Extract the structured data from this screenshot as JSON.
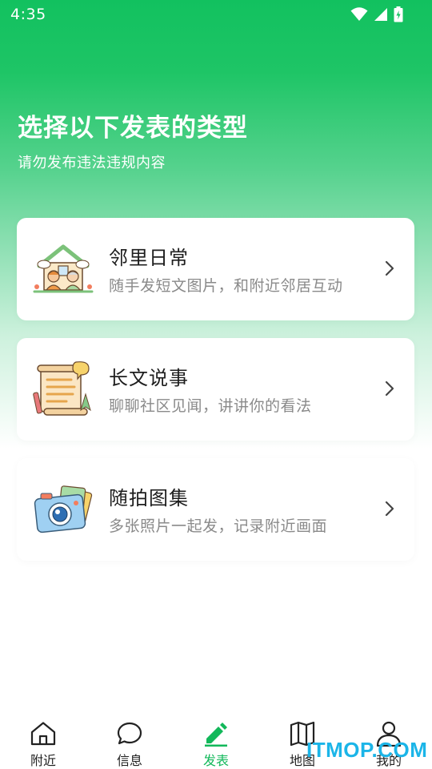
{
  "status_bar": {
    "time": "4:35"
  },
  "header": {
    "title": "选择以下发表的类型",
    "subtitle": "请勿发布违法违规内容"
  },
  "cards": [
    {
      "title": "邻里日常",
      "desc": "随手发短文图片，和附近邻居互动",
      "icon": "house-neighbors-icon"
    },
    {
      "title": "长文说事",
      "desc": "聊聊社区见闻，讲讲你的看法",
      "icon": "scroll-document-icon"
    },
    {
      "title": "随拍图集",
      "desc": "多张照片一起发，记录附近画面",
      "icon": "camera-photos-icon"
    }
  ],
  "tabs": [
    {
      "label": "附近",
      "icon": "home-icon",
      "active": false
    },
    {
      "label": "信息",
      "icon": "chat-bubble-icon",
      "active": false
    },
    {
      "label": "发表",
      "icon": "pencil-icon",
      "active": true
    },
    {
      "label": "地图",
      "icon": "map-icon",
      "active": false
    },
    {
      "label": "我的",
      "icon": "person-icon",
      "active": false
    }
  ],
  "watermark": "ITMOP.COM",
  "colors": {
    "accent": "#12c15f",
    "active_tab": "#12b85a"
  }
}
